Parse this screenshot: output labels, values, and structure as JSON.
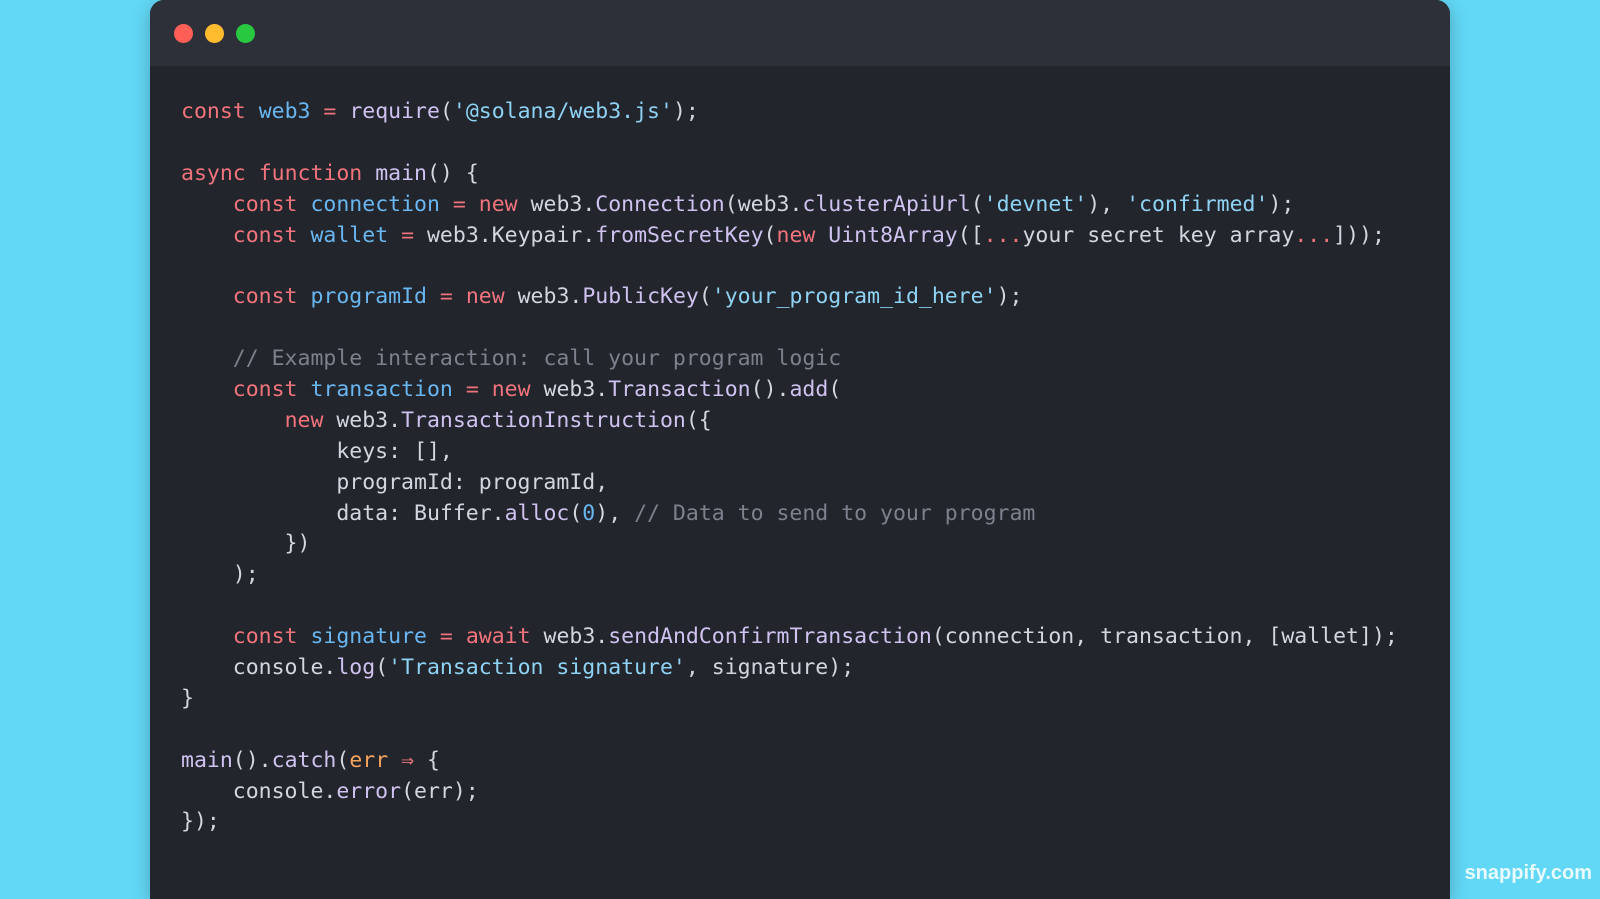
{
  "window": {
    "controls": [
      "close",
      "minimize",
      "maximize"
    ]
  },
  "colors": {
    "background": "#62d8f6",
    "editor": "#22252c",
    "titlebar": "#2d3038",
    "keyword": "#f1737b",
    "variable": "#69b6f0",
    "function": "#cfc2f0",
    "string": "#8fd3f4",
    "comment": "#7c818c",
    "parameter": "#f5a25d"
  },
  "code_lines": [
    [
      [
        "kw",
        "const"
      ],
      [
        "plain",
        " "
      ],
      [
        "var",
        "web3"
      ],
      [
        "plain",
        " "
      ],
      [
        "kw",
        "="
      ],
      [
        "plain",
        " "
      ],
      [
        "fn",
        "require"
      ],
      [
        "plain",
        "("
      ],
      [
        "str",
        "'@solana/web3.js'"
      ],
      [
        "plain",
        ");"
      ]
    ],
    [],
    [
      [
        "kw",
        "async"
      ],
      [
        "plain",
        " "
      ],
      [
        "kw",
        "function"
      ],
      [
        "plain",
        " "
      ],
      [
        "fn",
        "main"
      ],
      [
        "plain",
        "() {"
      ]
    ],
    [
      [
        "plain",
        "    "
      ],
      [
        "kw",
        "const"
      ],
      [
        "plain",
        " "
      ],
      [
        "var",
        "connection"
      ],
      [
        "plain",
        " "
      ],
      [
        "kw",
        "="
      ],
      [
        "plain",
        " "
      ],
      [
        "kw",
        "new"
      ],
      [
        "plain",
        " web3."
      ],
      [
        "fn",
        "Connection"
      ],
      [
        "plain",
        "(web3."
      ],
      [
        "fn",
        "clusterApiUrl"
      ],
      [
        "plain",
        "("
      ],
      [
        "str",
        "'devnet'"
      ],
      [
        "plain",
        "), "
      ],
      [
        "str",
        "'confirmed'"
      ],
      [
        "plain",
        ");"
      ]
    ],
    [
      [
        "plain",
        "    "
      ],
      [
        "kw",
        "const"
      ],
      [
        "plain",
        " "
      ],
      [
        "var",
        "wallet"
      ],
      [
        "plain",
        " "
      ],
      [
        "kw",
        "="
      ],
      [
        "plain",
        " web3.Keypair."
      ],
      [
        "fn",
        "fromSecretKey"
      ],
      [
        "plain",
        "("
      ],
      [
        "kw",
        "new"
      ],
      [
        "plain",
        " "
      ],
      [
        "fn",
        "Uint8Array"
      ],
      [
        "plain",
        "(["
      ],
      [
        "kw",
        "..."
      ],
      [
        "plain",
        "your secret key array"
      ],
      [
        "kw",
        "..."
      ],
      [
        "plain",
        "]));"
      ]
    ],
    [],
    [
      [
        "plain",
        "    "
      ],
      [
        "kw",
        "const"
      ],
      [
        "plain",
        " "
      ],
      [
        "var",
        "programId"
      ],
      [
        "plain",
        " "
      ],
      [
        "kw",
        "="
      ],
      [
        "plain",
        " "
      ],
      [
        "kw",
        "new"
      ],
      [
        "plain",
        " web3."
      ],
      [
        "fn",
        "PublicKey"
      ],
      [
        "plain",
        "("
      ],
      [
        "str",
        "'your_program_id_here'"
      ],
      [
        "plain",
        ");"
      ]
    ],
    [],
    [
      [
        "plain",
        "    "
      ],
      [
        "cmt",
        "// Example interaction: call your program logic"
      ]
    ],
    [
      [
        "plain",
        "    "
      ],
      [
        "kw",
        "const"
      ],
      [
        "plain",
        " "
      ],
      [
        "var",
        "transaction"
      ],
      [
        "plain",
        " "
      ],
      [
        "kw",
        "="
      ],
      [
        "plain",
        " "
      ],
      [
        "kw",
        "new"
      ],
      [
        "plain",
        " web3."
      ],
      [
        "fn",
        "Transaction"
      ],
      [
        "plain",
        "()."
      ],
      [
        "fn",
        "add"
      ],
      [
        "plain",
        "("
      ]
    ],
    [
      [
        "plain",
        "        "
      ],
      [
        "kw",
        "new"
      ],
      [
        "plain",
        " web3."
      ],
      [
        "fn",
        "TransactionInstruction"
      ],
      [
        "plain",
        "({"
      ]
    ],
    [
      [
        "plain",
        "            keys: [],"
      ]
    ],
    [
      [
        "plain",
        "            programId: programId,"
      ]
    ],
    [
      [
        "plain",
        "            data: Buffer."
      ],
      [
        "fn",
        "alloc"
      ],
      [
        "plain",
        "("
      ],
      [
        "num",
        "0"
      ],
      [
        "plain",
        "), "
      ],
      [
        "cmt",
        "// Data to send to your program"
      ]
    ],
    [
      [
        "plain",
        "        })"
      ]
    ],
    [
      [
        "plain",
        "    );"
      ]
    ],
    [],
    [
      [
        "plain",
        "    "
      ],
      [
        "kw",
        "const"
      ],
      [
        "plain",
        " "
      ],
      [
        "var",
        "signature"
      ],
      [
        "plain",
        " "
      ],
      [
        "kw",
        "="
      ],
      [
        "plain",
        " "
      ],
      [
        "kw",
        "await"
      ],
      [
        "plain",
        " web3."
      ],
      [
        "fn",
        "sendAndConfirmTransaction"
      ],
      [
        "plain",
        "(connection, transaction, [wallet]);"
      ]
    ],
    [
      [
        "plain",
        "    console."
      ],
      [
        "fn",
        "log"
      ],
      [
        "plain",
        "("
      ],
      [
        "str",
        "'Transaction signature'"
      ],
      [
        "plain",
        ", signature);"
      ]
    ],
    [
      [
        "plain",
        "}"
      ]
    ],
    [],
    [
      [
        "fn",
        "main"
      ],
      [
        "plain",
        "()."
      ],
      [
        "fn",
        "catch"
      ],
      [
        "plain",
        "("
      ],
      [
        "param",
        "err"
      ],
      [
        "plain",
        " "
      ],
      [
        "arrow",
        "⇒"
      ],
      [
        "plain",
        " {"
      ]
    ],
    [
      [
        "plain",
        "    console."
      ],
      [
        "fn",
        "error"
      ],
      [
        "plain",
        "(err);"
      ]
    ],
    [
      [
        "plain",
        "});"
      ]
    ]
  ],
  "watermark": "snappify.com"
}
